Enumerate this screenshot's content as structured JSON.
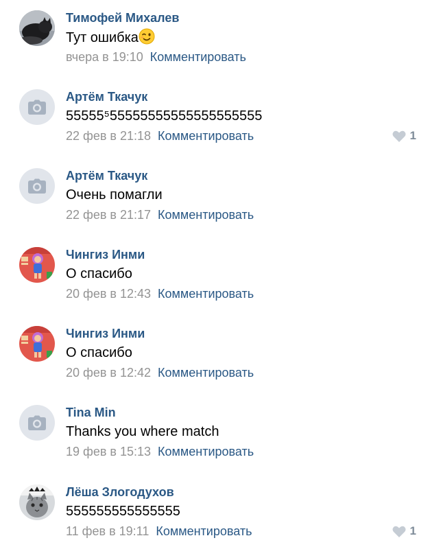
{
  "comments": [
    {
      "author": "Тимофей Михалев",
      "text": "Тут ошибка",
      "emoji": "winking-face",
      "date": "вчера в 19:10",
      "reply": "Комментировать",
      "avatar": "photo-dark-animal",
      "likes": ""
    },
    {
      "author": "Артём Ткачук",
      "text": "55555⁵55555555555555555555",
      "date": "22 фев в 21:18",
      "reply": "Комментировать",
      "avatar": "camera-placeholder",
      "likes": "1"
    },
    {
      "author": "Артём Ткачук",
      "text": "Очень помагли",
      "date": "22 фев в 21:17",
      "reply": "Комментировать",
      "avatar": "camera-placeholder",
      "likes": ""
    },
    {
      "author": "Чингиз Инми",
      "text": "О спасибо",
      "date": "20 фев в 12:43",
      "reply": "Комментировать",
      "avatar": "photo-game-character",
      "likes": ""
    },
    {
      "author": "Чингиз Инми",
      "text": "О спасибо",
      "date": "20 фев в 12:42",
      "reply": "Комментировать",
      "avatar": "photo-game-character",
      "likes": ""
    },
    {
      "author": "Tina Min",
      "text": "Thanks you where match",
      "date": "19 фев в 15:13",
      "reply": "Комментировать",
      "avatar": "camera-placeholder",
      "likes": ""
    },
    {
      "author": "Лёша Злогодухов",
      "text": "555555555555555",
      "date": "11 фев в 19:11",
      "reply": "Комментировать",
      "avatar": "photo-cat",
      "likes": "1"
    }
  ],
  "colors": {
    "author": "#2a5885",
    "link": "#2a5885",
    "date": "#939393",
    "text": "#000000",
    "placeholder_bg": "#e1e5eb",
    "heart": "#c5ccd4",
    "like_count": "#7f8c99"
  }
}
